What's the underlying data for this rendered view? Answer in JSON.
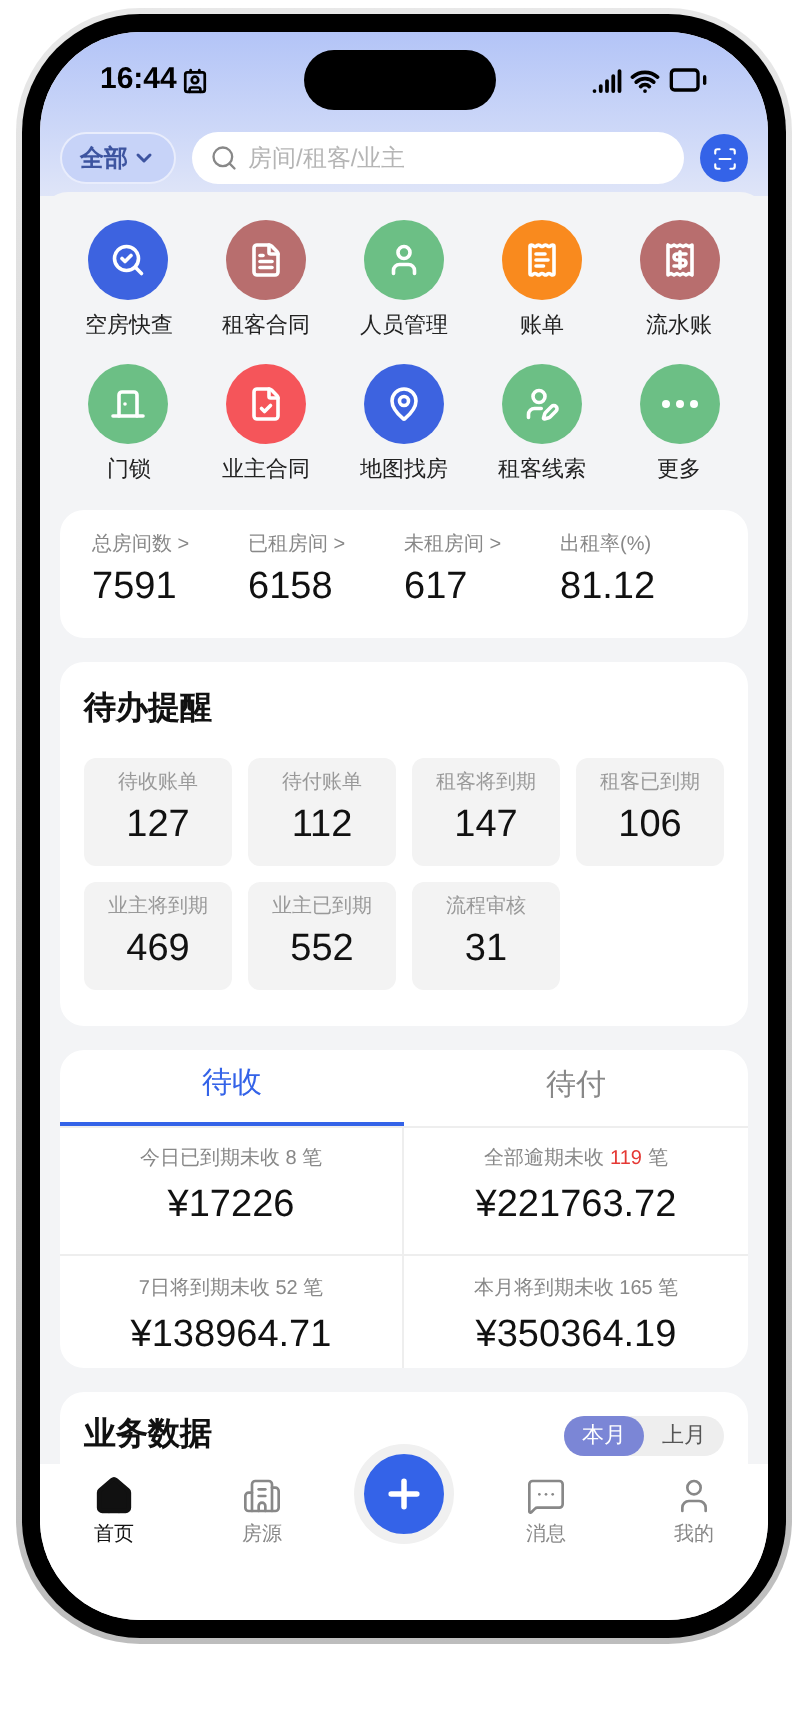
{
  "status_bar": {
    "time": "16:44"
  },
  "header": {
    "filter": "全部",
    "search": {
      "placeholder": "房间/租客/业主"
    }
  },
  "shortcuts": [
    {
      "label": "空房快查",
      "color": "#3d63e0"
    },
    {
      "label": "租客合同",
      "color": "#b86e6e"
    },
    {
      "label": "人员管理",
      "color": "#6cbf85"
    },
    {
      "label": "账单",
      "color": "#f98a1e"
    },
    {
      "label": "流水账",
      "color": "#b86e6e"
    },
    {
      "label": "门锁",
      "color": "#6cbf85"
    },
    {
      "label": "业主合同",
      "color": "#f5555a"
    },
    {
      "label": "地图找房",
      "color": "#3d63e0"
    },
    {
      "label": "租客线索",
      "color": "#6cbf85"
    },
    {
      "label": "更多",
      "color": "#6cbf85"
    }
  ],
  "stats": [
    {
      "label": "总房间数 >",
      "value": "7591"
    },
    {
      "label": "已租房间 >",
      "value": "6158"
    },
    {
      "label": "未租房间 >",
      "value": "617"
    },
    {
      "label": "出租率(%)",
      "value": "81.12"
    }
  ],
  "todo": {
    "title": "待办提醒",
    "items": [
      {
        "label": "待收账单",
        "value": "127"
      },
      {
        "label": "待付账单",
        "value": "112"
      },
      {
        "label": "租客将到期",
        "value": "147"
      },
      {
        "label": "租客已到期",
        "value": "106"
      },
      {
        "label": "业主将到期",
        "value": "469"
      },
      {
        "label": "业主已到期",
        "value": "552"
      },
      {
        "label": "流程审核",
        "value": "31"
      }
    ]
  },
  "receivables": {
    "tabs": [
      {
        "label": "待收",
        "selected": true
      },
      {
        "label": "待付",
        "selected": false
      }
    ],
    "cells": [
      {
        "label": "今日已到期未收",
        "count": "8",
        "unit": "笔",
        "alert": false,
        "amount": "¥17226"
      },
      {
        "label": "全部逾期未收",
        "count": "119",
        "unit": "笔",
        "alert": true,
        "amount": "¥221763.72"
      },
      {
        "label": "7日将到期未收",
        "count": "52",
        "unit": "笔",
        "alert": false,
        "amount": "¥138964.71"
      },
      {
        "label": "本月将到期未收",
        "count": "165",
        "unit": "笔",
        "alert": false,
        "amount": "¥350364.19"
      }
    ]
  },
  "business": {
    "title": "业务数据",
    "periods": [
      {
        "label": "本月",
        "selected": true
      },
      {
        "label": "上月",
        "selected": false
      }
    ]
  },
  "tab_bar": [
    {
      "label": "首页",
      "selected": true
    },
    {
      "label": "房源",
      "selected": false
    },
    {
      "label": "消息",
      "selected": false
    },
    {
      "label": "我的",
      "selected": false
    }
  ]
}
